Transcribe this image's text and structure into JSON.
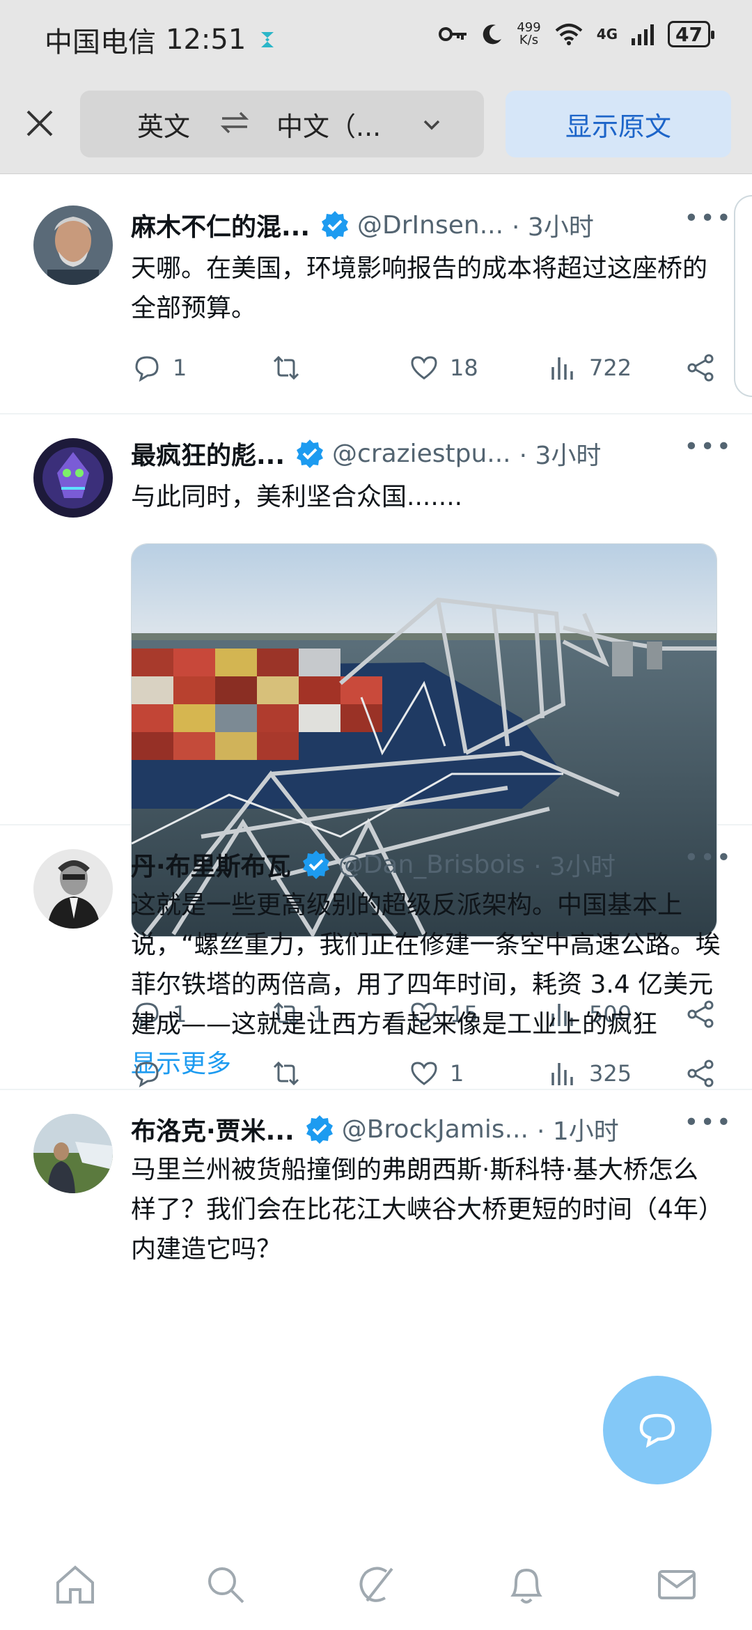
{
  "status_bar": {
    "carrier": "中国电信",
    "time": "12:51",
    "net_speed_value": "499",
    "net_speed_unit": "K/s",
    "network": "4G",
    "battery": "47"
  },
  "translate_bar": {
    "source_lang": "英文",
    "target_lang": "中文（...",
    "show_original": "显示原文"
  },
  "tweets": [
    {
      "name": "麻木不仁的混...",
      "handle": "@DrInsen...",
      "time": "· 3小时",
      "text": "天哪。在美国，环境影响报告的成本将超过这座桥的全部预算。",
      "replies": "1",
      "retweets": "",
      "likes": "18",
      "views": "722"
    },
    {
      "name": "最疯狂的彪...",
      "handle": "@craziestpu...",
      "time": "· 3小时",
      "text": "与此同时，美利坚合众国.......",
      "replies": "1",
      "retweets": "1",
      "likes": "15",
      "views": "500"
    },
    {
      "name": "丹·布里斯布瓦",
      "handle": "@Dan_Brisbois",
      "time": "· 3小时",
      "text": "这就是一些更高级别的超级反派架构。中国基本上说，“螺丝重力，我们正在修建一条空中高速公路。埃菲尔铁塔的两倍高，用了四年时间，耗资 3.4 亿美元建成——这就是让西方看起来像是工业上的疯狂",
      "show_more": "显示更多",
      "replies": "",
      "retweets": "",
      "likes": "1",
      "views": "325"
    },
    {
      "name": "布洛克·贾米...",
      "handle": "@BrockJamis...",
      "time": "· 1小时",
      "text": "马里兰州被货船撞倒的弗朗西斯·斯科特·基大桥怎么样了？我们会在比花江大峡谷大桥更短的时间（4年）内建造它吗？"
    }
  ],
  "colors": {
    "accent": "#1d9bf0",
    "muted": "#536471",
    "verified": "#1d9bf0"
  },
  "icons": [
    "close-icon",
    "swap-icon",
    "chevron-down-icon",
    "verified-icon",
    "more-icon",
    "reply-icon",
    "retweet-icon",
    "like-icon",
    "views-icon",
    "share-icon",
    "home-icon",
    "search-icon",
    "grok-icon",
    "notifications-icon",
    "messages-icon",
    "compose-icon"
  ]
}
